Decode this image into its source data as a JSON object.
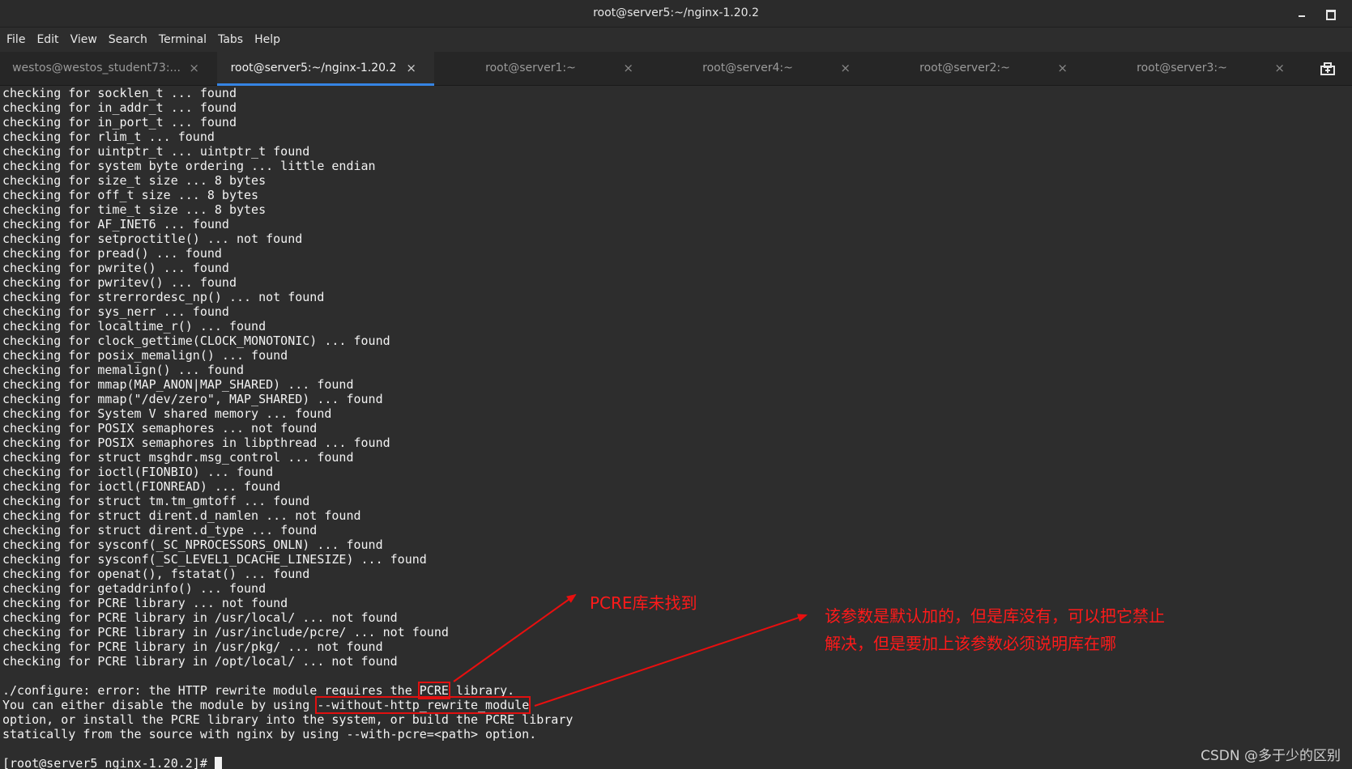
{
  "window": {
    "title": "root@server5:~/nginx-1.20.2"
  },
  "menu": [
    "File",
    "Edit",
    "View",
    "Search",
    "Terminal",
    "Tabs",
    "Help"
  ],
  "tabs": [
    {
      "label": "westos@westos_student73:...",
      "active": false
    },
    {
      "label": "root@server5:~/nginx-1.20.2",
      "active": true
    },
    {
      "label": "root@server1:~",
      "active": false
    },
    {
      "label": "root@server4:~",
      "active": false
    },
    {
      "label": "root@server2:~",
      "active": false
    },
    {
      "label": "root@server3:~",
      "active": false
    }
  ],
  "tab_close_glyph": "×",
  "terminal": {
    "lines": [
      "checking for socklen_t ... found",
      "checking for in_addr_t ... found",
      "checking for in_port_t ... found",
      "checking for rlim_t ... found",
      "checking for uintptr_t ... uintptr_t found",
      "checking for system byte ordering ... little endian",
      "checking for size_t size ... 8 bytes",
      "checking for off_t size ... 8 bytes",
      "checking for time_t size ... 8 bytes",
      "checking for AF_INET6 ... found",
      "checking for setproctitle() ... not found",
      "checking for pread() ... found",
      "checking for pwrite() ... found",
      "checking for pwritev() ... found",
      "checking for strerrordesc_np() ... not found",
      "checking for sys_nerr ... found",
      "checking for localtime_r() ... found",
      "checking for clock_gettime(CLOCK_MONOTONIC) ... found",
      "checking for posix_memalign() ... found",
      "checking for memalign() ... found",
      "checking for mmap(MAP_ANON|MAP_SHARED) ... found",
      "checking for mmap(\"/dev/zero\", MAP_SHARED) ... found",
      "checking for System V shared memory ... found",
      "checking for POSIX semaphores ... not found",
      "checking for POSIX semaphores in libpthread ... found",
      "checking for struct msghdr.msg_control ... found",
      "checking for ioctl(FIONBIO) ... found",
      "checking for ioctl(FIONREAD) ... found",
      "checking for struct tm.tm_gmtoff ... found",
      "checking for struct dirent.d_namlen ... not found",
      "checking for struct dirent.d_type ... found",
      "checking for sysconf(_SC_NPROCESSORS_ONLN) ... found",
      "checking for sysconf(_SC_LEVEL1_DCACHE_LINESIZE) ... found",
      "checking for openat(), fstatat() ... found",
      "checking for getaddrinfo() ... found",
      "checking for PCRE library ... not found",
      "checking for PCRE library in /usr/local/ ... not found",
      "checking for PCRE library in /usr/include/pcre/ ... not found",
      "checking for PCRE library in /usr/pkg/ ... not found",
      "checking for PCRE library in /opt/local/ ... not found",
      ""
    ],
    "error_line1_pre": "./configure: error: the HTTP rewrite module requires the ",
    "error_line1_highlight": "PCRE",
    "error_line1_post": " library.",
    "error_line2_pre": "You can either disable the module by using ",
    "error_line2_highlight": "--without-http_rewrite_module",
    "error_line3": "option, or install the PCRE library into the system, or build the PCRE library",
    "error_line4": "statically from the source with nginx by using --with-pcre=<path> option.",
    "blank": "",
    "prompt": "[root@server5 nginx-1.20.2]# "
  },
  "annotations": {
    "pcre_note": "PCRE库未找到",
    "param_note_line1": "该参数是默认加的，但是库没有，可以把它禁止",
    "param_note_line2": "解决，但是要加上该参数必须说明库在哪",
    "color": "#ff1a1a"
  },
  "watermark": "CSDN @多于少的区别"
}
